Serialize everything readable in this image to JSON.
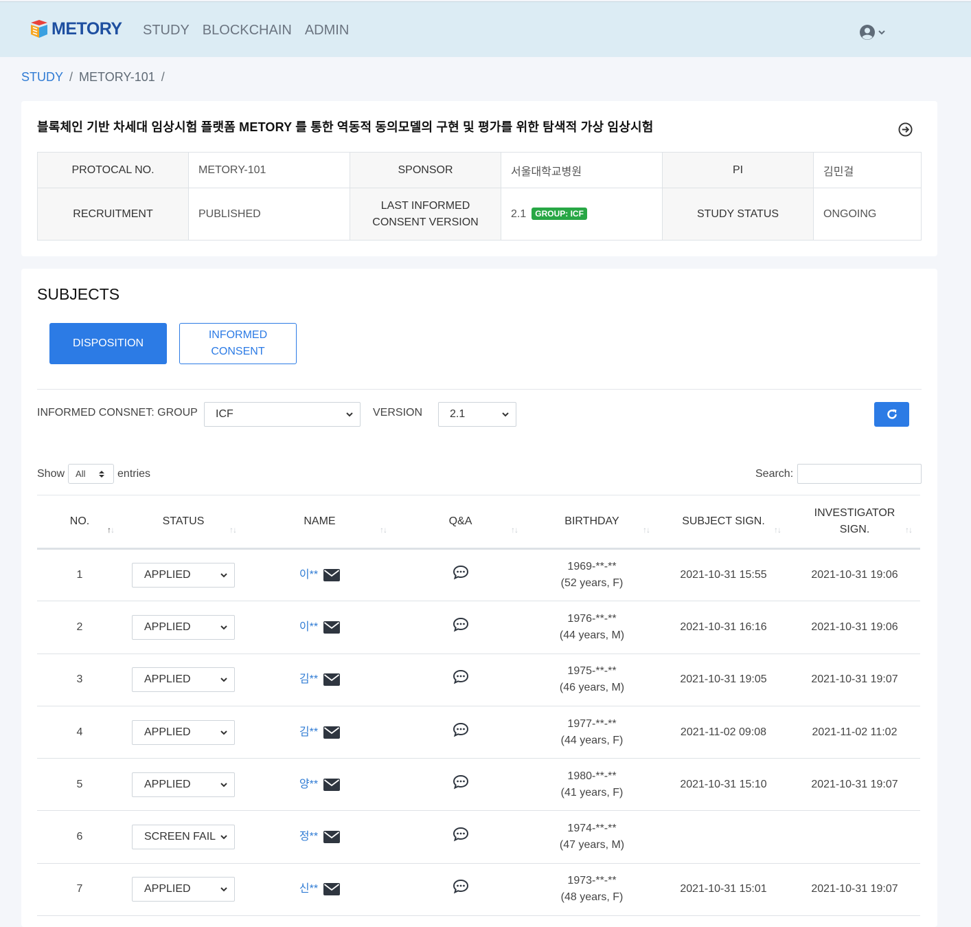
{
  "app": {
    "logo_text": "METORY",
    "nav": [
      "STUDY",
      "BLOCKCHAIN",
      "ADMIN"
    ]
  },
  "breadcrumb": {
    "items": [
      "STUDY",
      "METORY-101"
    ],
    "separator": "/"
  },
  "study": {
    "title": "블록체인 기반 차세대 임상시험 플랫폼 METORY 를 통한 역동적 동의모델의 구현 및 평가를 위한 탐색적 가상 임상시험",
    "protocol_label": "PROTOCAL NO.",
    "protocol_value": "METORY-101",
    "sponsor_label": "SPONSOR",
    "sponsor_value": "서울대학교병원",
    "pi_label": "PI",
    "pi_value": "김민걸",
    "recruitment_label": "RECRUITMENT",
    "recruitment_value": "PUBLISHED",
    "consent_version_label_1": "LAST INFORMED",
    "consent_version_label_2": "CONSENT VERSION",
    "consent_version_value": "2.1",
    "consent_group_badge": "GROUP: ICF",
    "status_label": "STUDY STATUS",
    "status_value": "ONGOING"
  },
  "subjects": {
    "title": "SUBJECTS",
    "tab_disposition": "DISPOSITION",
    "tab_consent_1": "INFORMED",
    "tab_consent_2": "CONSENT",
    "group_label": "INFORMED CONSNET: GROUP",
    "group_value": "ICF",
    "version_label": "VERSION",
    "version_value": "2.1",
    "show_label": "Show",
    "show_value": "All",
    "entries_label": "entries",
    "search_label": "Search:",
    "columns": {
      "no": "NO.",
      "status": "STATUS",
      "name": "NAME",
      "qa": "Q&A",
      "birthday": "BIRTHDAY",
      "subject_sign": "SUBJECT SIGN.",
      "investigator_sign_1": "INVESTIGATOR",
      "investigator_sign_2": "SIGN."
    },
    "rows": [
      {
        "no": "1",
        "status": "APPLIED",
        "name": "이**",
        "birth": "1969-**-**",
        "age": "(52 years, F)",
        "subject_sign": "2021-10-31 15:55",
        "inv_sign": "2021-10-31 19:06"
      },
      {
        "no": "2",
        "status": "APPLIED",
        "name": "이**",
        "birth": "1976-**-**",
        "age": "(44 years, M)",
        "subject_sign": "2021-10-31 16:16",
        "inv_sign": "2021-10-31 19:06"
      },
      {
        "no": "3",
        "status": "APPLIED",
        "name": "김**",
        "birth": "1975-**-**",
        "age": "(46 years, M)",
        "subject_sign": "2021-10-31 19:05",
        "inv_sign": "2021-10-31 19:07"
      },
      {
        "no": "4",
        "status": "APPLIED",
        "name": "김**",
        "birth": "1977-**-**",
        "age": "(44 years, F)",
        "subject_sign": "2021-11-02 09:08",
        "inv_sign": "2021-11-02 11:02"
      },
      {
        "no": "5",
        "status": "APPLIED",
        "name": "양**",
        "birth": "1980-**-**",
        "age": "(41 years, F)",
        "subject_sign": "2021-10-31 15:10",
        "inv_sign": "2021-10-31 19:07"
      },
      {
        "no": "6",
        "status": "SCREEN FAIL",
        "name": "정**",
        "birth": "1974-**-**",
        "age": "(47 years, M)",
        "subject_sign": "",
        "inv_sign": ""
      },
      {
        "no": "7",
        "status": "APPLIED",
        "name": "신**",
        "birth": "1973-**-**",
        "age": "(48 years, F)",
        "subject_sign": "2021-10-31 15:01",
        "inv_sign": "2021-10-31 19:07"
      }
    ]
  },
  "colors": {
    "primary": "#2c7be5",
    "link": "#2f7bd4",
    "header_bg": "#dcecf4",
    "badge": "#28a745"
  }
}
